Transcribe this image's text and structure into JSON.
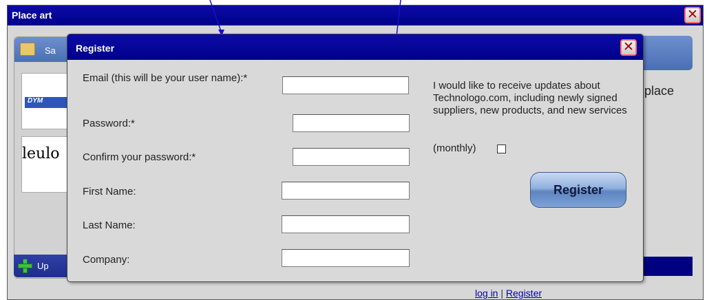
{
  "background": {
    "window_title": "Place art",
    "close_glyph": "✕",
    "folder_tab_label": "Sa",
    "upload_label": "Up",
    "place_text": "place",
    "thumb_dymo_text": "DYM",
    "thumb_logo_text": "leulo",
    "links": {
      "login": "log in",
      "separator": " | ",
      "register": "Register"
    }
  },
  "dialog": {
    "title": "Register",
    "close_glyph": "✕",
    "fields": [
      {
        "label": "Email (this will be your user name):*",
        "value": ""
      },
      {
        "label": "Password:*",
        "value": ""
      },
      {
        "label": "Confirm your password:*",
        "value": ""
      },
      {
        "label": "First Name:",
        "value": ""
      },
      {
        "label": "Last Name:",
        "value": ""
      },
      {
        "label": "Company:",
        "value": ""
      }
    ],
    "updates_text": "I would like to receive updates about Technologo.com, including newly signed suppliers, new products, and new services",
    "monthly_label": "(monthly)",
    "monthly_checked": false,
    "register_button": "Register"
  },
  "colors": {
    "titlebar": "#00008a",
    "accent": "#4a6fb4"
  }
}
